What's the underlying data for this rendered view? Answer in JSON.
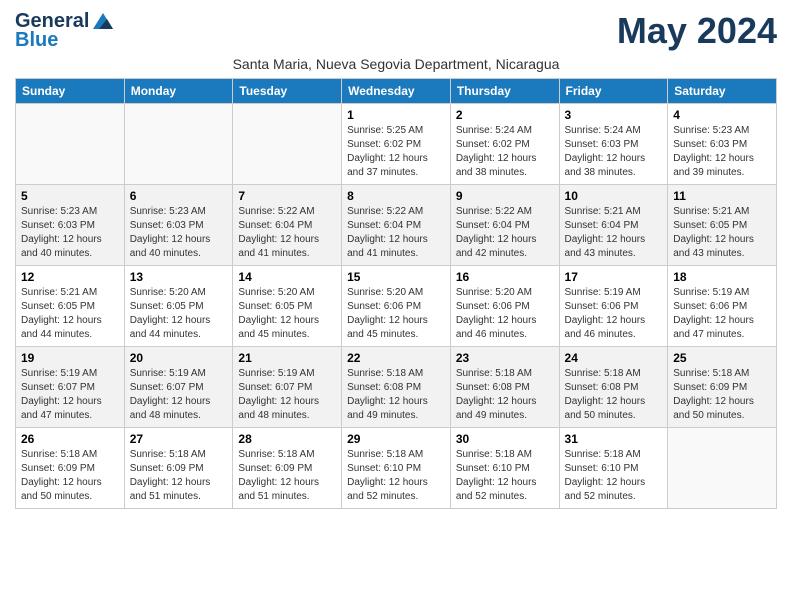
{
  "logo": {
    "text_general": "General",
    "text_blue": "Blue",
    "tagline": ""
  },
  "header": {
    "month_title": "May 2024",
    "subtitle": "Santa Maria, Nueva Segovia Department, Nicaragua"
  },
  "weekdays": [
    "Sunday",
    "Monday",
    "Tuesday",
    "Wednesday",
    "Thursday",
    "Friday",
    "Saturday"
  ],
  "weeks": [
    {
      "days": [
        {
          "num": "",
          "info": ""
        },
        {
          "num": "",
          "info": ""
        },
        {
          "num": "",
          "info": ""
        },
        {
          "num": "1",
          "info": "Sunrise: 5:25 AM\nSunset: 6:02 PM\nDaylight: 12 hours and 37 minutes."
        },
        {
          "num": "2",
          "info": "Sunrise: 5:24 AM\nSunset: 6:02 PM\nDaylight: 12 hours and 38 minutes."
        },
        {
          "num": "3",
          "info": "Sunrise: 5:24 AM\nSunset: 6:03 PM\nDaylight: 12 hours and 38 minutes."
        },
        {
          "num": "4",
          "info": "Sunrise: 5:23 AM\nSunset: 6:03 PM\nDaylight: 12 hours and 39 minutes."
        }
      ]
    },
    {
      "days": [
        {
          "num": "5",
          "info": "Sunrise: 5:23 AM\nSunset: 6:03 PM\nDaylight: 12 hours and 40 minutes."
        },
        {
          "num": "6",
          "info": "Sunrise: 5:23 AM\nSunset: 6:03 PM\nDaylight: 12 hours and 40 minutes."
        },
        {
          "num": "7",
          "info": "Sunrise: 5:22 AM\nSunset: 6:04 PM\nDaylight: 12 hours and 41 minutes."
        },
        {
          "num": "8",
          "info": "Sunrise: 5:22 AM\nSunset: 6:04 PM\nDaylight: 12 hours and 41 minutes."
        },
        {
          "num": "9",
          "info": "Sunrise: 5:22 AM\nSunset: 6:04 PM\nDaylight: 12 hours and 42 minutes."
        },
        {
          "num": "10",
          "info": "Sunrise: 5:21 AM\nSunset: 6:04 PM\nDaylight: 12 hours and 43 minutes."
        },
        {
          "num": "11",
          "info": "Sunrise: 5:21 AM\nSunset: 6:05 PM\nDaylight: 12 hours and 43 minutes."
        }
      ]
    },
    {
      "days": [
        {
          "num": "12",
          "info": "Sunrise: 5:21 AM\nSunset: 6:05 PM\nDaylight: 12 hours and 44 minutes."
        },
        {
          "num": "13",
          "info": "Sunrise: 5:20 AM\nSunset: 6:05 PM\nDaylight: 12 hours and 44 minutes."
        },
        {
          "num": "14",
          "info": "Sunrise: 5:20 AM\nSunset: 6:05 PM\nDaylight: 12 hours and 45 minutes."
        },
        {
          "num": "15",
          "info": "Sunrise: 5:20 AM\nSunset: 6:06 PM\nDaylight: 12 hours and 45 minutes."
        },
        {
          "num": "16",
          "info": "Sunrise: 5:20 AM\nSunset: 6:06 PM\nDaylight: 12 hours and 46 minutes."
        },
        {
          "num": "17",
          "info": "Sunrise: 5:19 AM\nSunset: 6:06 PM\nDaylight: 12 hours and 46 minutes."
        },
        {
          "num": "18",
          "info": "Sunrise: 5:19 AM\nSunset: 6:06 PM\nDaylight: 12 hours and 47 minutes."
        }
      ]
    },
    {
      "days": [
        {
          "num": "19",
          "info": "Sunrise: 5:19 AM\nSunset: 6:07 PM\nDaylight: 12 hours and 47 minutes."
        },
        {
          "num": "20",
          "info": "Sunrise: 5:19 AM\nSunset: 6:07 PM\nDaylight: 12 hours and 48 minutes."
        },
        {
          "num": "21",
          "info": "Sunrise: 5:19 AM\nSunset: 6:07 PM\nDaylight: 12 hours and 48 minutes."
        },
        {
          "num": "22",
          "info": "Sunrise: 5:18 AM\nSunset: 6:08 PM\nDaylight: 12 hours and 49 minutes."
        },
        {
          "num": "23",
          "info": "Sunrise: 5:18 AM\nSunset: 6:08 PM\nDaylight: 12 hours and 49 minutes."
        },
        {
          "num": "24",
          "info": "Sunrise: 5:18 AM\nSunset: 6:08 PM\nDaylight: 12 hours and 50 minutes."
        },
        {
          "num": "25",
          "info": "Sunrise: 5:18 AM\nSunset: 6:09 PM\nDaylight: 12 hours and 50 minutes."
        }
      ]
    },
    {
      "days": [
        {
          "num": "26",
          "info": "Sunrise: 5:18 AM\nSunset: 6:09 PM\nDaylight: 12 hours and 50 minutes."
        },
        {
          "num": "27",
          "info": "Sunrise: 5:18 AM\nSunset: 6:09 PM\nDaylight: 12 hours and 51 minutes."
        },
        {
          "num": "28",
          "info": "Sunrise: 5:18 AM\nSunset: 6:09 PM\nDaylight: 12 hours and 51 minutes."
        },
        {
          "num": "29",
          "info": "Sunrise: 5:18 AM\nSunset: 6:10 PM\nDaylight: 12 hours and 52 minutes."
        },
        {
          "num": "30",
          "info": "Sunrise: 5:18 AM\nSunset: 6:10 PM\nDaylight: 12 hours and 52 minutes."
        },
        {
          "num": "31",
          "info": "Sunrise: 5:18 AM\nSunset: 6:10 PM\nDaylight: 12 hours and 52 minutes."
        },
        {
          "num": "",
          "info": ""
        }
      ]
    }
  ]
}
